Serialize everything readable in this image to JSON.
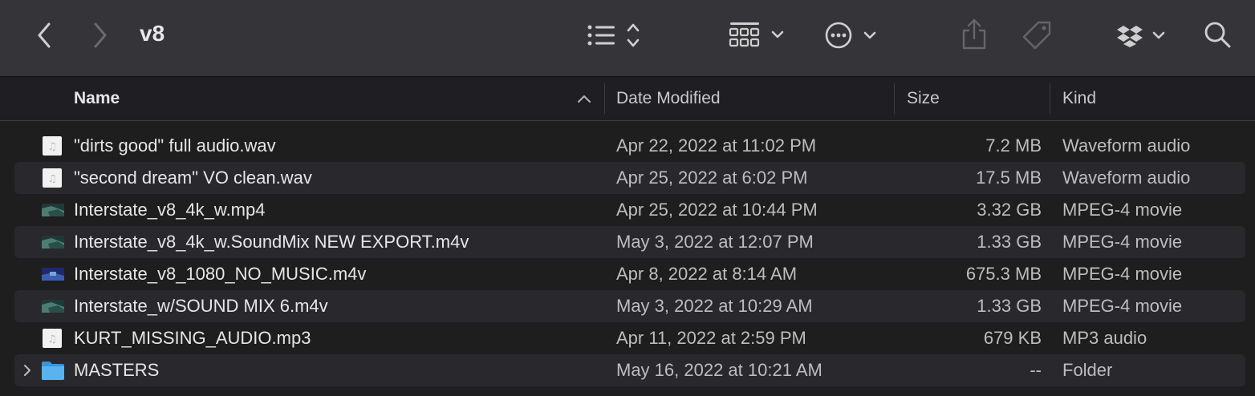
{
  "window": {
    "title": "v8"
  },
  "toolbar": {
    "back": "back-chevron",
    "forward": "forward-chevron",
    "view_mode": "list-view",
    "group_by": "grid-group",
    "action": "more-actions",
    "share": "share",
    "tags": "tag",
    "dropbox": "dropbox",
    "search": "search"
  },
  "columns": {
    "name": "Name",
    "date": "Date Modified",
    "size": "Size",
    "kind": "Kind"
  },
  "files": [
    {
      "name": "\"dirts good\" full audio.wav",
      "date": "Apr 22, 2022 at 11:02 PM",
      "size": "7.2 MB",
      "kind": "Waveform audio",
      "icon": "audio"
    },
    {
      "name": "\"second dream\" VO clean.wav",
      "date": "Apr 25, 2022 at 6:02 PM",
      "size": "17.5 MB",
      "kind": "Waveform audio",
      "icon": "audio"
    },
    {
      "name": "Interstate_v8_4k_w.mp4",
      "date": "Apr 25, 2022 at 10:44 PM",
      "size": "3.32 GB",
      "kind": "MPEG-4 movie",
      "icon": "video"
    },
    {
      "name": "Interstate_v8_4k_w.SoundMix NEW EXPORT.m4v",
      "date": "May 3, 2022 at 12:07 PM",
      "size": "1.33 GB",
      "kind": "MPEG-4 movie",
      "icon": "video"
    },
    {
      "name": "Interstate_v8_1080_NO_MUSIC.m4v",
      "date": "Apr 8, 2022 at 8:14 AM",
      "size": "675.3 MB",
      "kind": "MPEG-4 movie",
      "icon": "video-blue"
    },
    {
      "name": "Interstate_w/SOUND MIX 6.m4v",
      "date": "May 3, 2022 at 10:29 AM",
      "size": "1.33 GB",
      "kind": "MPEG-4 movie",
      "icon": "video"
    },
    {
      "name": "KURT_MISSING_AUDIO.mp3",
      "date": "Apr 11, 2022 at 2:59 PM",
      "size": "679 KB",
      "kind": "MP3 audio",
      "icon": "audio"
    },
    {
      "name": "MASTERS",
      "date": "May 16, 2022 at 10:21 AM",
      "size": "--",
      "kind": "Folder",
      "icon": "folder"
    }
  ]
}
